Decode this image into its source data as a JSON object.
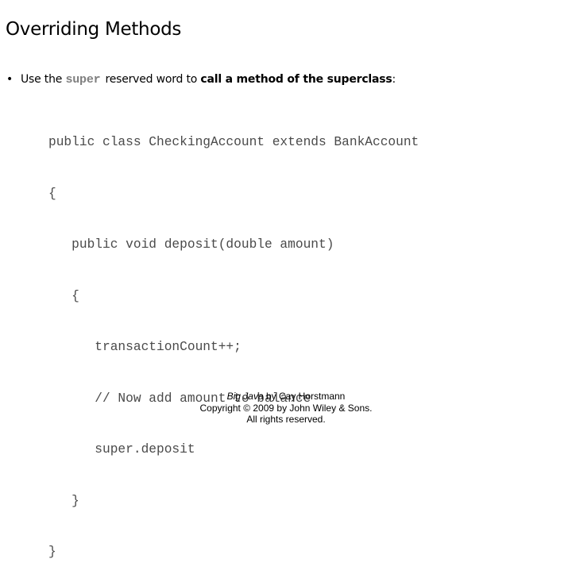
{
  "slide": {
    "title": "Overriding Methods",
    "bullet": {
      "marker": "•",
      "prefix": "Use the ",
      "keyword": "super",
      "middle": "reserved word to ",
      "emphasis": "call a method of the superclass",
      "suffix": ":"
    },
    "code_lines": [
      "public class CheckingAccount extends BankAccount",
      "{",
      "   public void deposit(double amount)",
      "   {",
      "      transactionCount++;",
      "      // Now add amount to balance",
      "      super.deposit",
      "   }",
      "}"
    ],
    "footer": {
      "book_title": "Big Java",
      "byline": " by Cay Horstmann",
      "copyright": "Copyright © 2009 by John Wiley & Sons.",
      "rights": "All rights reserved."
    }
  }
}
